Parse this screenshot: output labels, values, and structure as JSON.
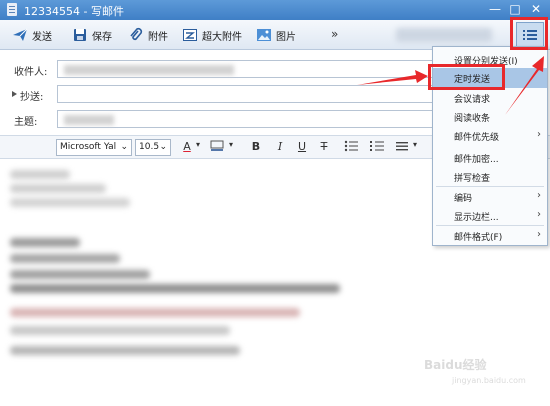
{
  "window": {
    "title": "12334554 - 写邮件"
  },
  "toolbar": {
    "send": "发送",
    "save": "保存",
    "attach": "附件",
    "big_attach": "超大附件",
    "image": "图片",
    "more": "»"
  },
  "form": {
    "to_label": "收件人:",
    "cc_label": "抄送:",
    "subject_label": "主题:"
  },
  "format": {
    "font": "Microsoft Yal",
    "size": "10.5",
    "font_color_glyph": "A",
    "bold": "B",
    "italic": "I",
    "underline": "U",
    "strike": "T"
  },
  "menu": {
    "items": [
      {
        "label": "设置分别发送(I)",
        "has_submenu": false
      },
      {
        "label": "定时发送",
        "has_submenu": false,
        "active": true
      },
      {
        "label": "会议请求",
        "has_submenu": false
      },
      {
        "label": "阅读收条",
        "has_submenu": false
      },
      {
        "label": "邮件优先级",
        "has_submenu": true
      },
      {
        "label": "邮件加密...",
        "has_submenu": false
      },
      {
        "label": "拼写检查",
        "has_submenu": false
      },
      {
        "label": "编码",
        "has_submenu": true
      },
      {
        "label": "显示边栏...",
        "has_submenu": true
      },
      {
        "label": "邮件格式(F)",
        "has_submenu": true
      }
    ]
  },
  "watermark": {
    "text": "Baidu经验",
    "sub": "jingyan.baidu.com"
  },
  "colors": {
    "titlebar": "#4a8ad0",
    "highlight": "#e8282b",
    "menu_active": "#a9c6e6"
  }
}
